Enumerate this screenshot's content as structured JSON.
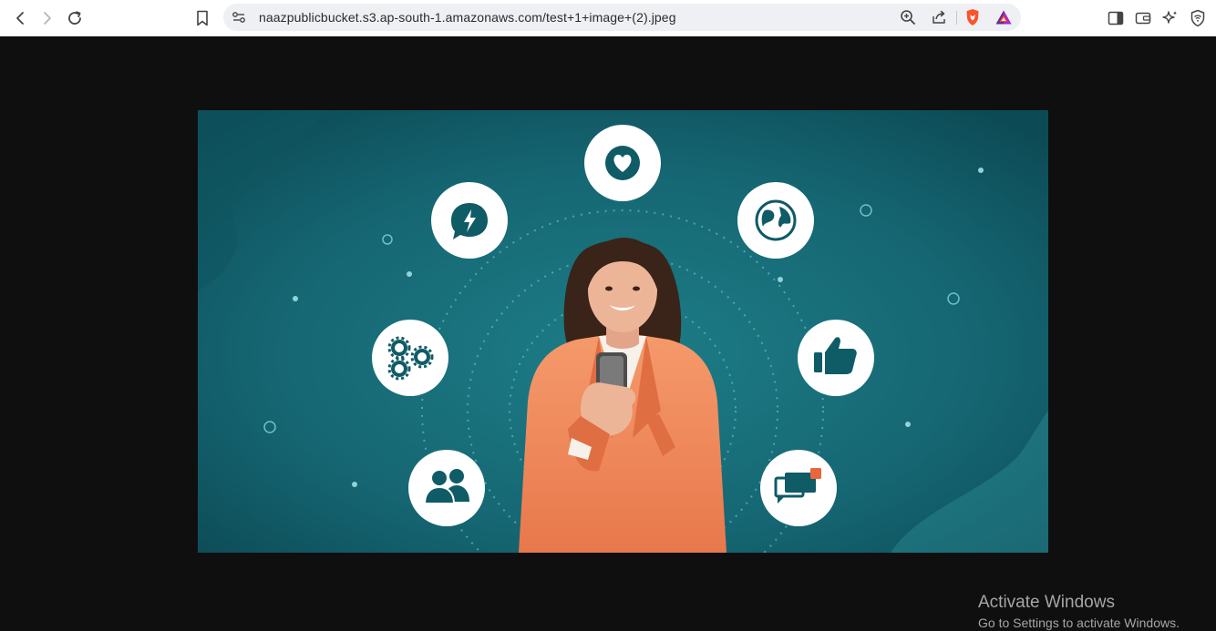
{
  "browser": {
    "url": "naazpublicbucket.s3.ap-south-1.amazonaws.com/test+1+image+(2).jpeg",
    "toolbar_icons": [
      "back-icon",
      "forward-icon",
      "reload-icon",
      "bookmark-icon",
      "site-settings-icon",
      "zoom-icon",
      "share-icon",
      "brave-shields-icon",
      "brave-rewards-icon",
      "sidebar-icon",
      "wallet-icon",
      "leo-ai-icon",
      "vpn-icon"
    ]
  },
  "image": {
    "description_icons": [
      "heart-icon",
      "chat-bolt-icon",
      "globe-icon",
      "gears-icon",
      "thumbs-up-icon",
      "users-icon",
      "chat-notification-icon"
    ],
    "colors": {
      "background": "#16646e",
      "accent_circle": "#ffffff",
      "icon": "#0f5b66",
      "jacket": "#f08a5c"
    }
  },
  "watermark": {
    "title": "Activate Windows",
    "subtitle": "Go to Settings to activate Windows."
  }
}
